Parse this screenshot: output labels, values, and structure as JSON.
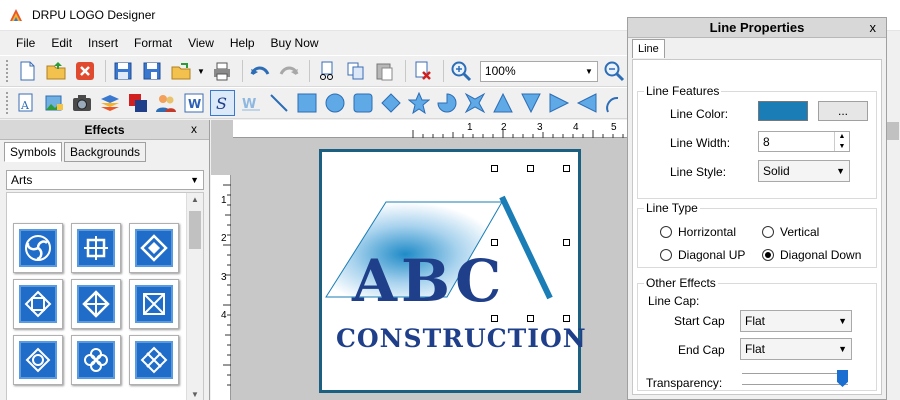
{
  "app": {
    "title": "DRPU LOGO Designer"
  },
  "menu": [
    "File",
    "Edit",
    "Insert",
    "Format",
    "View",
    "Help",
    "Buy Now"
  ],
  "toolbar": {
    "zoom_value": "100%"
  },
  "effects_panel": {
    "title": "Effects",
    "close": "x",
    "tabs": [
      "Symbols",
      "Backgrounds"
    ],
    "category": "Arts"
  },
  "ruler": {
    "h_marks": [
      "1",
      "2",
      "3",
      "4",
      "5"
    ],
    "v_marks": [
      "1",
      "2",
      "3",
      "4"
    ]
  },
  "logo": {
    "big_text": "ABC",
    "sub_text": "CONSTRUCTION"
  },
  "line_properties": {
    "title": "Line Properties",
    "close": "x",
    "tab": "Line",
    "features": {
      "legend": "Line Features",
      "color_label": "Line Color:",
      "color_value": "#1a7db5",
      "more_button": "...",
      "width_label": "Line Width:",
      "width_value": "8",
      "style_label": "Line Style:",
      "style_value": "Solid"
    },
    "line_type": {
      "legend": "Line Type",
      "options": [
        "Horrizontal",
        "Vertical",
        "Diagonal UP",
        "Diagonal Down"
      ],
      "selected": "Diagonal Down"
    },
    "other": {
      "legend": "Other Effects",
      "cap_label": "Line Cap:",
      "start_label": "Start Cap",
      "start_value": "Flat",
      "end_label": "End Cap",
      "end_value": "Flat",
      "transparency_label": "Transparency:",
      "transparency_value": 1.0
    }
  },
  "colors": {
    "brand_blue": "#1f3f8a",
    "line_teal": "#1a7db5",
    "panel_bg": "#f0f0f0"
  }
}
